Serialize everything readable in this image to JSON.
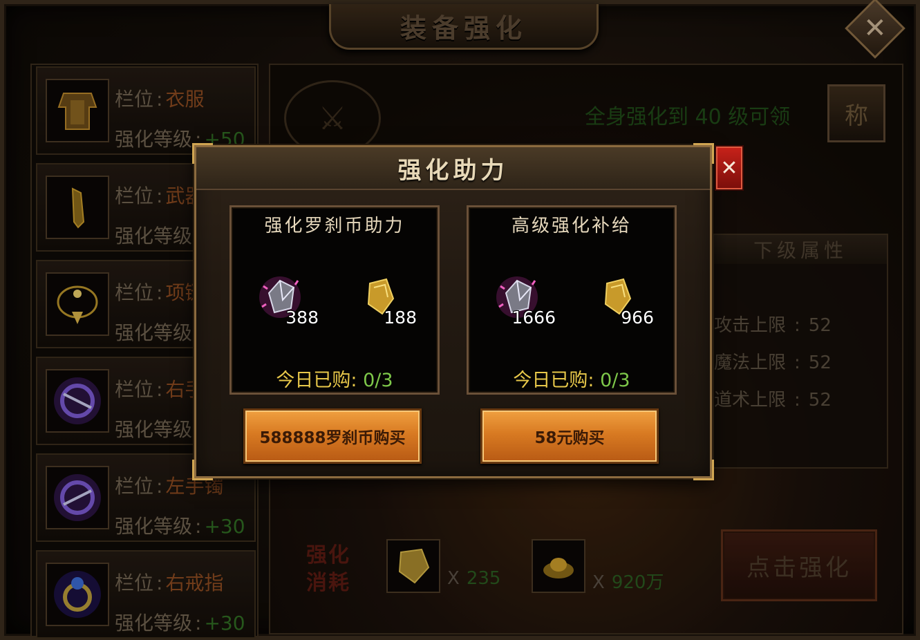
{
  "window": {
    "title": "装备强化",
    "close_icon": "close-icon"
  },
  "slots": [
    {
      "slot_label": "栏位",
      "slot_value": "衣服",
      "level_label": "强化等级",
      "level_value": "+50",
      "icon": "armor-icon"
    },
    {
      "slot_label": "栏位",
      "slot_value": "武器",
      "level_label": "强化等级",
      "level_value": "",
      "icon": "sword-icon"
    },
    {
      "slot_label": "栏位",
      "slot_value": "项链",
      "level_label": "强化等级",
      "level_value": "",
      "icon": "necklace-icon"
    },
    {
      "slot_label": "栏位",
      "slot_value": "右手镯",
      "level_label": "强化等级",
      "level_value": "",
      "icon": "bracelet-icon"
    },
    {
      "slot_label": "栏位",
      "slot_value": "左手镯",
      "level_label": "强化等级",
      "level_value": "+30",
      "icon": "bracelet-icon"
    },
    {
      "slot_label": "栏位",
      "slot_value": "右戒指",
      "level_label": "强化等级",
      "level_value": "+30",
      "icon": "ring-icon"
    }
  ],
  "main": {
    "reward_text": "全身强化到 40 级可领",
    "title_badge": "称",
    "next_attrs_title": "下级属性",
    "attrs": [
      {
        "label": "攻击上限",
        "value": "52"
      },
      {
        "label": "魔法上限",
        "value": "52"
      },
      {
        "label": "道术上限",
        "value": "52"
      }
    ],
    "cost_label": "强化消耗",
    "costs": [
      {
        "icon": "enhance-stone-icon",
        "x": "X",
        "qty": "235"
      },
      {
        "icon": "gold-ingot-icon",
        "x": "X",
        "qty": "920万"
      }
    ],
    "enhance_button": "点击强化"
  },
  "modal": {
    "title": "强化助力",
    "close_icon": "close-icon",
    "offers": [
      {
        "title": "强化罗刹币助力",
        "items": [
          {
            "icon": "crystal-icon",
            "count": "388"
          },
          {
            "icon": "enhance-stone-icon",
            "count": "188"
          }
        ],
        "bought_label": "今日已购:",
        "bought_value": "0/3",
        "button": "588888罗刹币购买"
      },
      {
        "title": "高级强化补给",
        "items": [
          {
            "icon": "crystal-icon",
            "count": "1666"
          },
          {
            "icon": "enhance-stone-icon",
            "count": "966"
          }
        ],
        "bought_label": "今日已购:",
        "bought_value": "0/3",
        "button": "58元购买"
      }
    ]
  },
  "colors": {
    "accent_gold": "#d0a552",
    "button_orange": "#d87a22",
    "bought_green": "#7ec84a",
    "bought_yellow": "#e8c84a",
    "close_red": "#c8221a"
  }
}
